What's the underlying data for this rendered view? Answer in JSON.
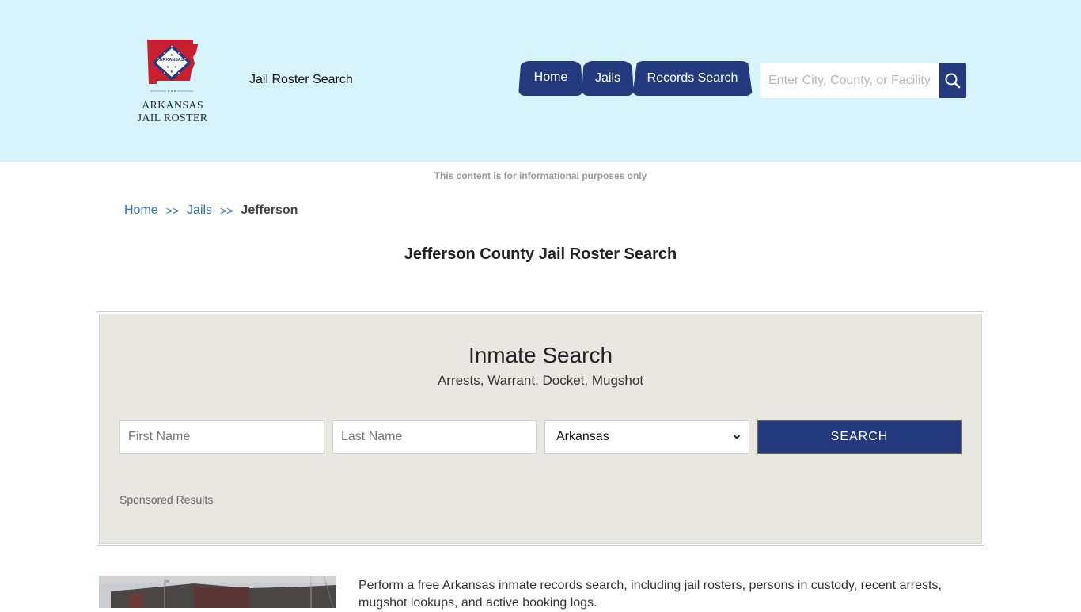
{
  "header": {
    "logo": {
      "state_label": "ARKANSAS",
      "line1": "ARKANSAS",
      "line2": "JAIL ROSTER"
    },
    "tagline": "Jail Roster Search",
    "nav": [
      {
        "label": "Home"
      },
      {
        "label": "Jails"
      },
      {
        "label": "Records Search"
      }
    ],
    "search": {
      "placeholder": "Enter City, County, or Facility",
      "icon": "search-icon"
    }
  },
  "disclaimer": "This content is for informational purposes only",
  "breadcrumb": {
    "items": [
      {
        "label": "Home"
      },
      {
        "label": "Jails"
      }
    ],
    "separator": ">>",
    "current": "Jefferson"
  },
  "page_title": "Jefferson County Jail Roster Search",
  "inmate_search": {
    "title": "Inmate Search",
    "subtitle": "Arrests, Warrant, Docket, Mugshot",
    "first_name_placeholder": "First Name",
    "last_name_placeholder": "Last Name",
    "state_selected": "Arkansas",
    "button_label": "SEARCH",
    "sponsored_label": "Sponsored Results"
  },
  "intro": {
    "text": "Perform a free Arkansas inmate records search, including jail rosters, persons in custody, recent arrests, mugshot lookups, and active booking logs."
  },
  "colors": {
    "header_bg": "#d7f3fc",
    "brand_navy": "#243a7f",
    "link_blue": "#2e6fc4",
    "panel_bg": "#e8e7e2"
  }
}
